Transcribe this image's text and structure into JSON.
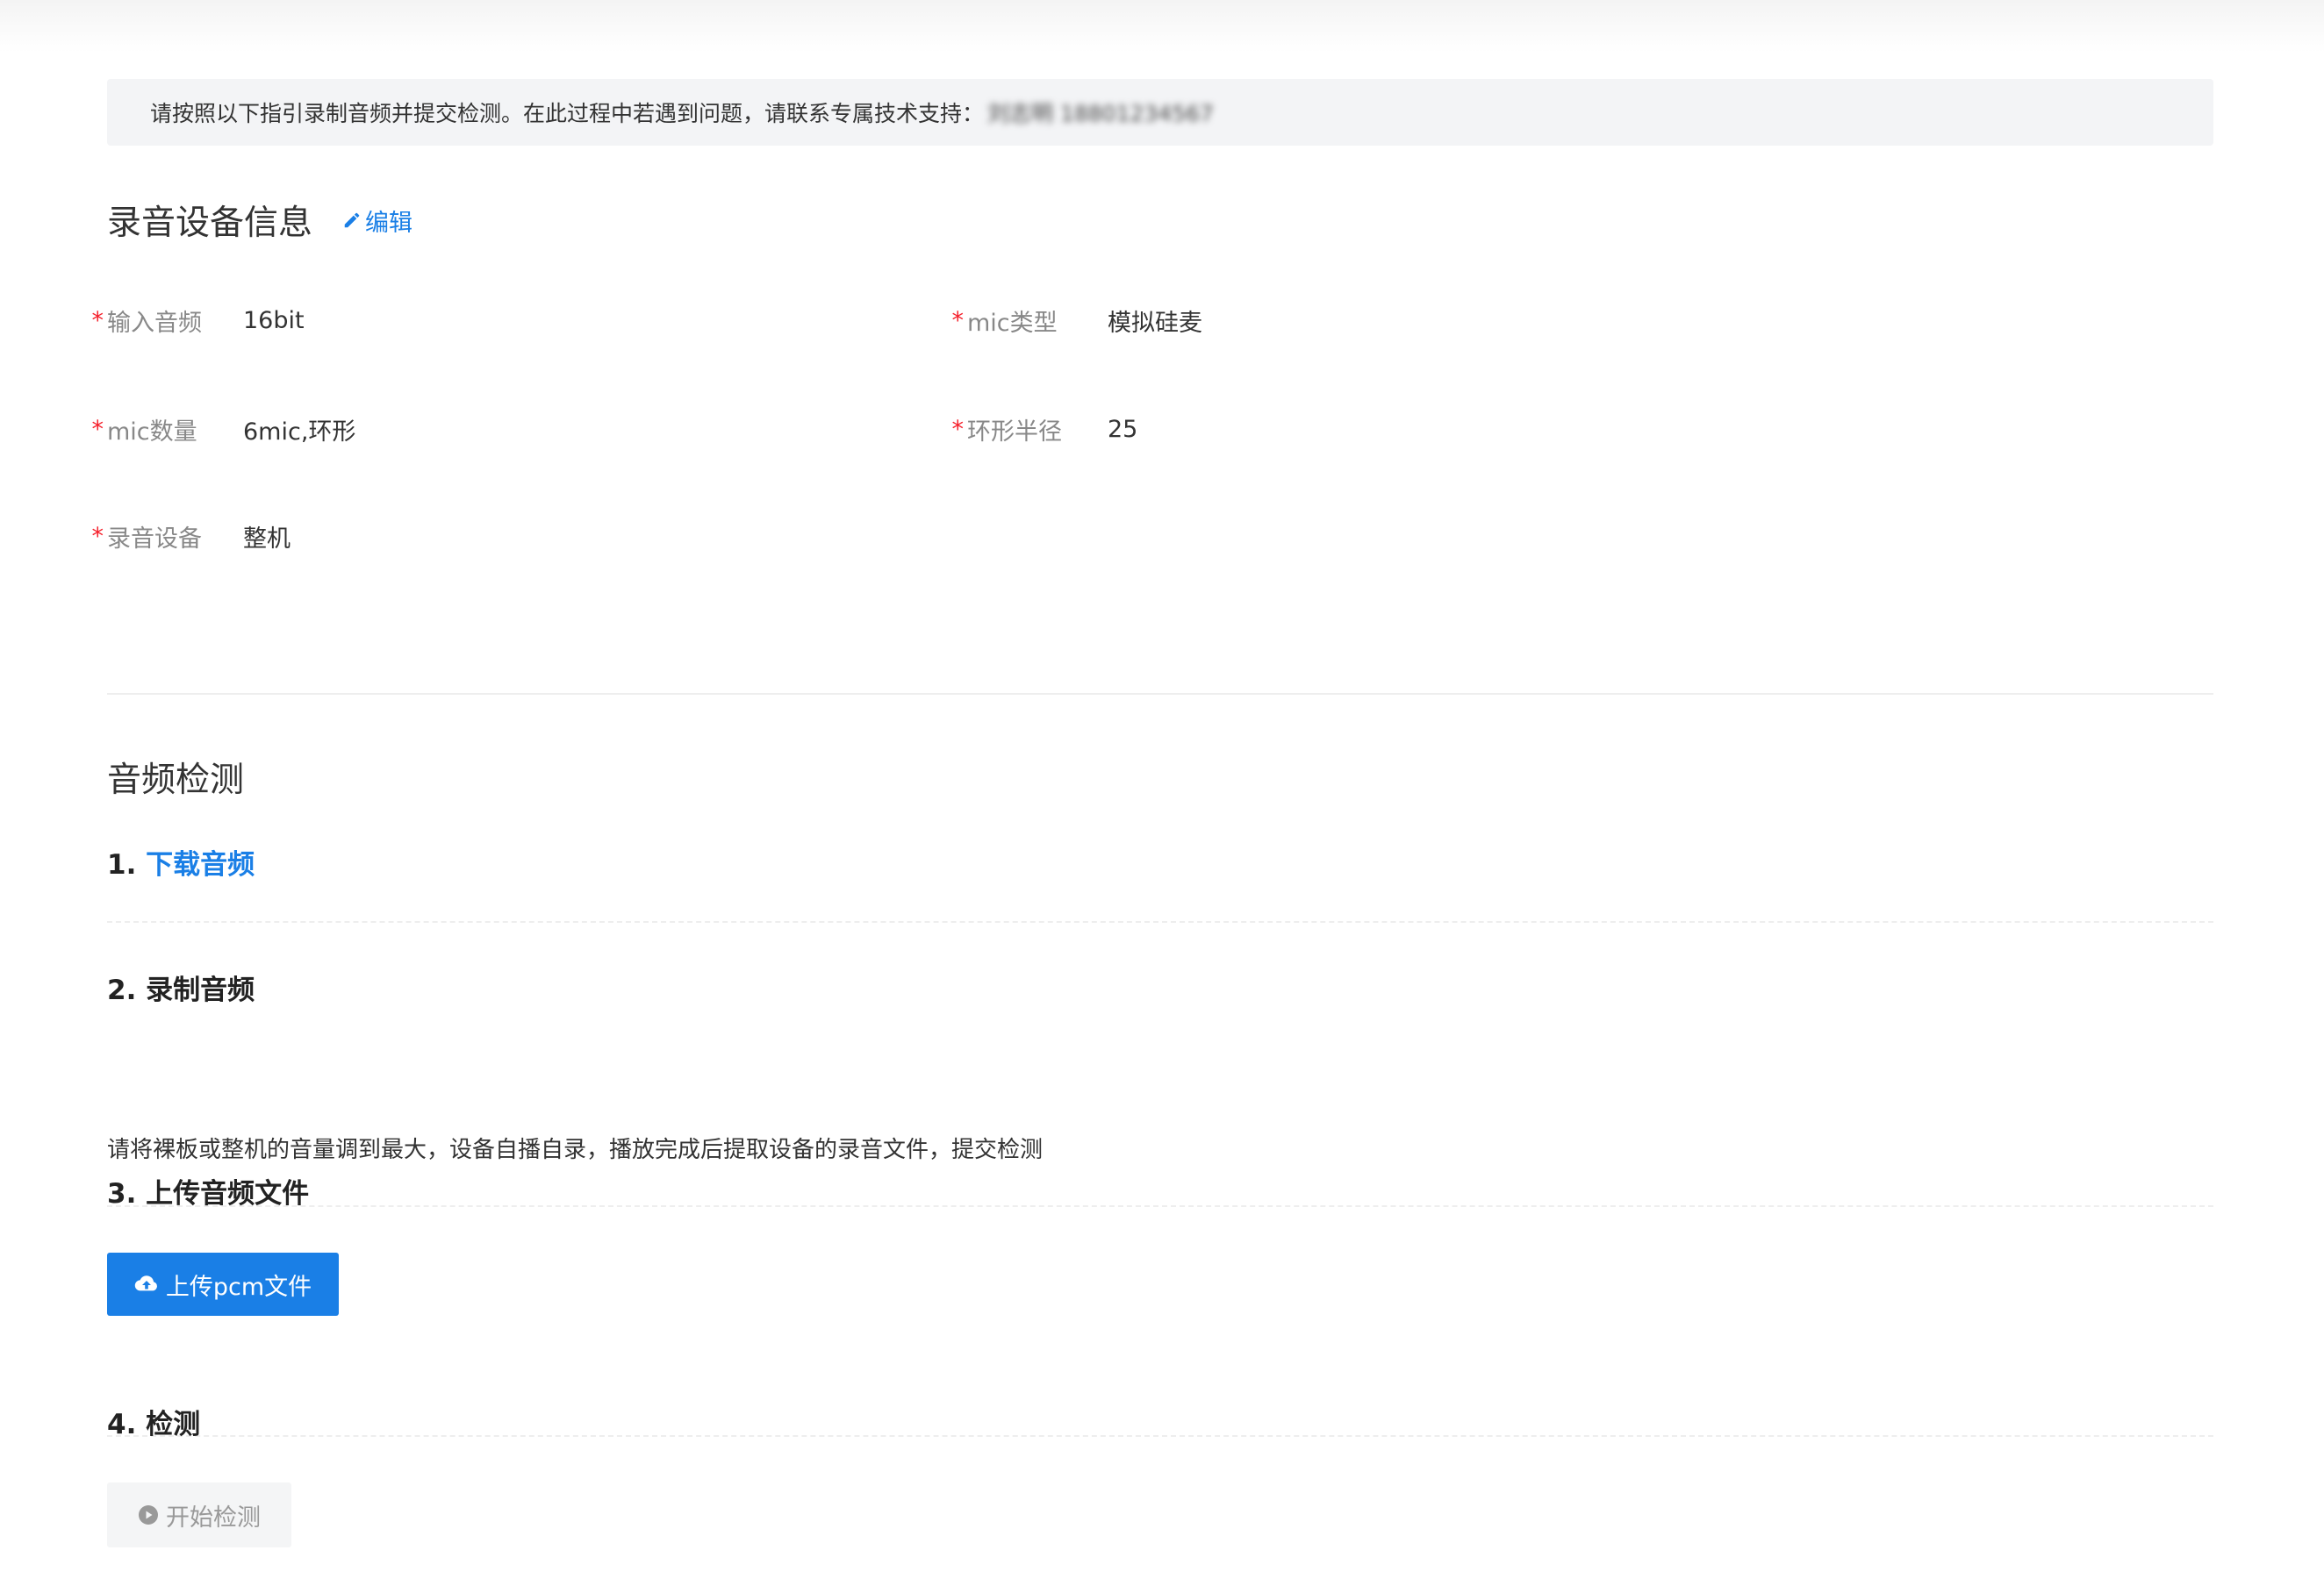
{
  "notice": {
    "text": "请按照以下指引录制音频并提交检测。在此过程中若遇到问题，请联系专属技术支持：",
    "contact": "刘志明 18801234567"
  },
  "device_info": {
    "title": "录音设备信息",
    "edit_label": "编辑",
    "fields": [
      {
        "label": "输入音频",
        "value": "16bit",
        "required": "*"
      },
      {
        "label": "mic类型",
        "value": "模拟硅麦",
        "required": "*"
      },
      {
        "label": "mic数量",
        "value": "6mic,环形",
        "required": "*"
      },
      {
        "label": "环形半径",
        "value": "25",
        "required": "*"
      },
      {
        "label": "录音设备",
        "value": "整机",
        "required": "*"
      }
    ]
  },
  "audio_check": {
    "title": "音频检测",
    "steps": [
      {
        "num": "1.",
        "label": "下载音频"
      },
      {
        "num": "2.",
        "label": "录制音频",
        "desc": "请将裸板或整机的音量调到最大，设备自播自录，播放完成后提取设备的录音文件，提交检测"
      },
      {
        "num": "3.",
        "label": "上传音频文件",
        "button": "上传pcm文件"
      },
      {
        "num": "4.",
        "label": "检测",
        "button": "开始检测"
      }
    ]
  },
  "colors": {
    "accent": "#1a7fe6",
    "required": "#f5222d",
    "notice_bg": "#f3f4f6"
  },
  "icons": {
    "edit": "pencil-icon",
    "upload": "cloud-upload-icon",
    "start": "play-circle-icon"
  }
}
